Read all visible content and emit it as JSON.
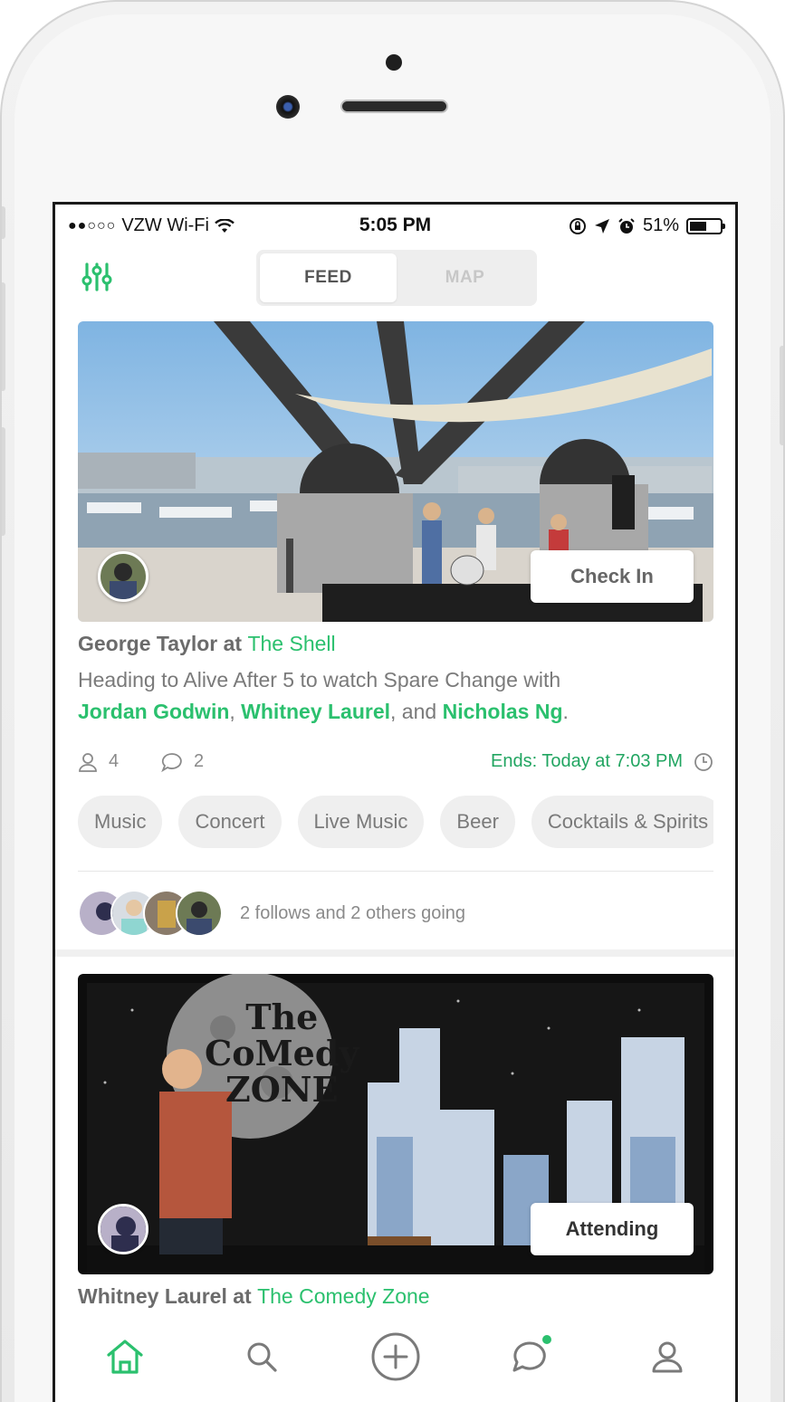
{
  "status_bar": {
    "signal": "●●○○○",
    "carrier": "VZW Wi-Fi",
    "time": "5:05 PM",
    "battery": "51%"
  },
  "top_bar": {
    "tabs": [
      {
        "label": "FEED",
        "active": true
      },
      {
        "label": "MAP",
        "active": false
      }
    ]
  },
  "feed": [
    {
      "action_label": "Check In",
      "user": "George Taylor",
      "at": "at",
      "venue": "The Shell",
      "description_prefix": "Heading to  Alive After 5 to watch Spare Change with",
      "mentions": [
        "Jordan Godwin",
        "Whitney Laurel",
        "Nicholas Ng"
      ],
      "separator_1": ",",
      "separator_2": ",  and",
      "end_period": ".",
      "people_count": "4",
      "comment_count": "2",
      "ends": "Ends: Today at 7:03 PM",
      "tags": [
        "Music",
        "Concert",
        "Live Music",
        "Beer",
        "Cocktails & Spirits"
      ],
      "going_text": "2 follows and 2 others going"
    },
    {
      "action_label": "Attending",
      "user": "Whitney Laurel",
      "at": "at",
      "venue": "The Comedy Zone",
      "photo_text_line1": "The",
      "photo_text_line2": "CoMedy",
      "photo_text_line3": "ZONE"
    }
  ],
  "tab_bar": {
    "items": [
      "home-icon",
      "search-icon",
      "add-icon",
      "chat-icon",
      "profile-icon"
    ]
  },
  "colors": {
    "accent": "#2bc06e",
    "text_gray": "#7a7a7a"
  }
}
